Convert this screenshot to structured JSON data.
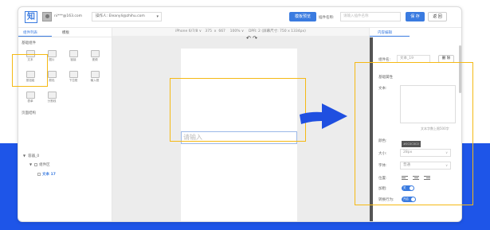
{
  "header": {
    "logo": "知",
    "email": "ni***@163.com",
    "operator": "操作人: Eleanyli@zhihu.com",
    "preview_label": "模板预览",
    "plugin_name_label": "插件名称:",
    "plugin_name_placeholder": "请输入插件名称",
    "save_label": "保 存",
    "back_label": "返 回"
  },
  "left": {
    "tabs": [
      "组件列表",
      "模板"
    ],
    "basic_components_title": "基础组件",
    "components": [
      {
        "label": "文本",
        "icon": "text-icon"
      },
      {
        "label": "图片",
        "icon": "image-icon"
      },
      {
        "label": "链接",
        "icon": "link-icon"
      },
      {
        "label": "视频",
        "icon": "video-icon"
      },
      {
        "label": "按钮组",
        "icon": "button-group-icon"
      },
      {
        "label": "颜色",
        "icon": "color-icon"
      },
      {
        "label": "下拉框",
        "icon": "dropdown-icon"
      },
      {
        "label": "输入框",
        "icon": "input-icon"
      },
      {
        "label": "表单",
        "icon": "form-icon"
      },
      {
        "label": "分割线",
        "icon": "divider-icon"
      }
    ],
    "page_structure_title": "页面结构",
    "tree": [
      {
        "label": "容器_0",
        "level": 0
      },
      {
        "label": "组件区",
        "level": 1
      },
      {
        "label": "文本 17",
        "level": 2,
        "active": true
      }
    ]
  },
  "canvas": {
    "device_bar": "iPhone 6/7/8 ∨   375  x  667    100% ∨    DPR: 2 (屏幕尺寸: 750 x 1334px)",
    "input_placeholder": "请输入"
  },
  "right": {
    "tab": "内容编辑",
    "component_name_label": "组件名:",
    "component_name_value": "文本_19",
    "delete_label": "删 除",
    "basic_props_title": "基础属性",
    "text_label": "文本:",
    "text_hint": "文本字数上限500字",
    "color_label": "颜色:",
    "color_value": "#0C0C0C0",
    "size_label": "大小:",
    "size_value": "28px",
    "font_label": "字体:",
    "font_value": "普通",
    "position_label": "位置:",
    "bold_label": "加粗:",
    "bold_toggle": "关",
    "wrap_label": "转换行为:",
    "wrap_toggle": "开启"
  },
  "colors": {
    "accent": "#3a7be0",
    "highlight": "#f5b914",
    "background_blue": "#1e55e8"
  }
}
